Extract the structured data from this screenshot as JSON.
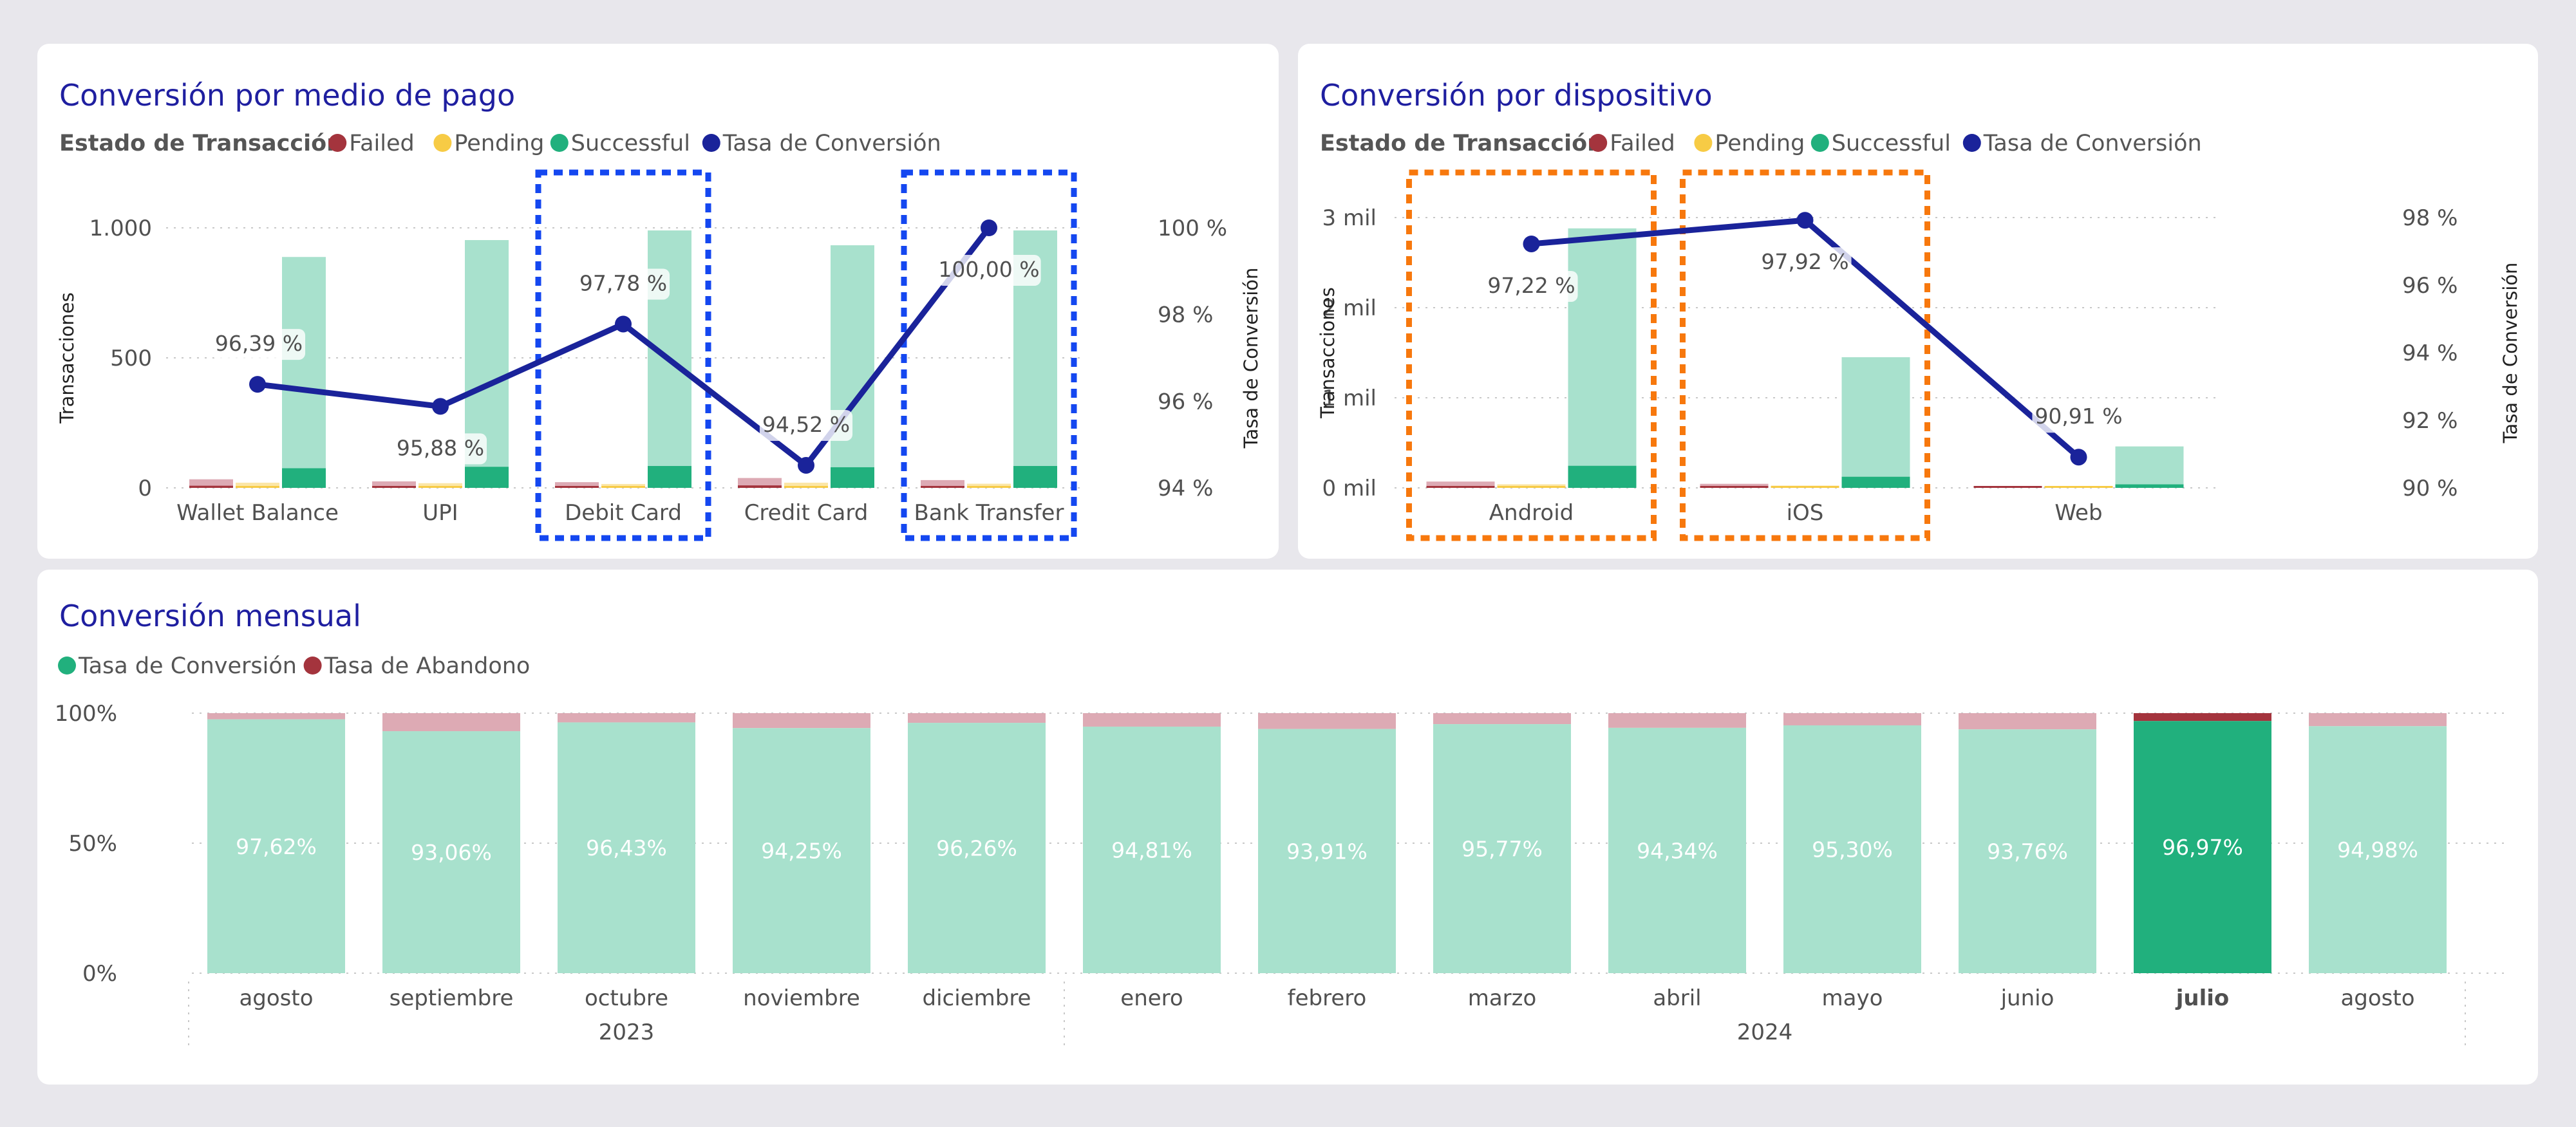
{
  "colors": {
    "failed": "#A4343D",
    "failed_light": "#DDAAB4",
    "pending": "#F7CB45",
    "pending_light": "#FBE6A7",
    "successful": "#21B07D",
    "successful_light": "#A8E1CD",
    "rate": "#1A239A",
    "title": "#1F1FA0",
    "highlight_blue": "#1447F0",
    "highlight_orange": "#F7780D"
  },
  "chart_data": [
    {
      "type": "bar",
      "title": "Conversión por medio de pago",
      "legend_title": "Estado de Transacción",
      "legend": [
        "Failed",
        "Pending",
        "Successful",
        "Tasa de Conversión"
      ],
      "categories": [
        "Wallet Balance",
        "UPI",
        "Debit Card",
        "Credit Card",
        "Bank Transfer"
      ],
      "highlighted": [
        "Debit Card",
        "Bank Transfer"
      ],
      "ylabel": "Transacciones",
      "y2label": "Tasa de Conversión",
      "ylim": [
        0,
        1000
      ],
      "yticks": [
        "0",
        "500",
        "1.000"
      ],
      "y2lim": [
        94,
        100
      ],
      "y2ticks": [
        "94 %",
        "96 %",
        "98 %",
        "100 %"
      ],
      "series": [
        {
          "name": "Failed",
          "values": [
            33,
            25,
            22,
            38,
            30
          ]
        },
        {
          "name": "Pending",
          "values": [
            20,
            18,
            15,
            20,
            16
          ]
        },
        {
          "name": "Successful",
          "values": [
            888,
            953,
            990,
            933,
            990
          ]
        },
        {
          "name": "Tasa de Conversión",
          "values": [
            96.39,
            95.88,
            97.78,
            94.52,
            100.0
          ],
          "labels": [
            "96,39 %",
            "95,88 %",
            "97,78 %",
            "94,52 %",
            "100,00 %"
          ]
        }
      ]
    },
    {
      "type": "bar",
      "title": "Conversión por dispositivo",
      "legend_title": "Estado de Transacción",
      "legend": [
        "Failed",
        "Pending",
        "Successful",
        "Tasa de Conversión"
      ],
      "categories": [
        "Android",
        "iOS",
        "Web"
      ],
      "highlighted": [
        "Android",
        "iOS"
      ],
      "ylabel": "Transacciones",
      "y2label": "Tasa de Conversión",
      "ylim": [
        0,
        3000
      ],
      "yticks": [
        "0 mil",
        "1 mil",
        "2 mil",
        "3 mil"
      ],
      "y2lim": [
        90,
        98
      ],
      "y2ticks": [
        "90 %",
        "92 %",
        "94 %",
        "96 %",
        "98 %"
      ],
      "series": [
        {
          "name": "Failed",
          "values": [
            70,
            45,
            10
          ]
        },
        {
          "name": "Pending",
          "values": [
            40,
            25,
            8
          ]
        },
        {
          "name": "Successful",
          "values": [
            2880,
            1450,
            460
          ]
        },
        {
          "name": "Tasa de Conversión",
          "values": [
            97.22,
            97.92,
            90.91
          ],
          "labels": [
            "97,22 %",
            "97,92 %",
            "90,91 %"
          ]
        }
      ]
    },
    {
      "type": "bar",
      "title": "Conversión mensual",
      "legend": [
        "Tasa de Conversión",
        "Tasa de Abandono"
      ],
      "categories": [
        "agosto",
        "septiembre",
        "octubre",
        "noviembre",
        "diciembre",
        "enero",
        "febrero",
        "marzo",
        "abril",
        "mayo",
        "junio",
        "julio",
        "agosto"
      ],
      "year_groups": [
        {
          "label": "2023",
          "span": 5
        },
        {
          "label": "2024",
          "span": 8
        }
      ],
      "highlighted": [
        "julio"
      ],
      "ylim": [
        0,
        100
      ],
      "yticks": [
        "0%",
        "50%",
        "100%"
      ],
      "series": [
        {
          "name": "Tasa de Conversión",
          "values": [
            97.62,
            93.06,
            96.43,
            94.25,
            96.26,
            94.81,
            93.91,
            95.77,
            94.34,
            95.3,
            93.76,
            96.97,
            94.98
          ],
          "labels": [
            "97,62%",
            "93,06%",
            "96,43%",
            "94,25%",
            "96,26%",
            "94,81%",
            "93,91%",
            "95,77%",
            "94,34%",
            "95,30%",
            "93,76%",
            "96,97%",
            "94,98%"
          ]
        },
        {
          "name": "Tasa de Abandono",
          "values": [
            2.38,
            6.94,
            3.57,
            5.75,
            3.74,
            5.19,
            6.09,
            4.23,
            5.66,
            4.7,
            6.24,
            3.03,
            5.02
          ]
        }
      ]
    }
  ]
}
